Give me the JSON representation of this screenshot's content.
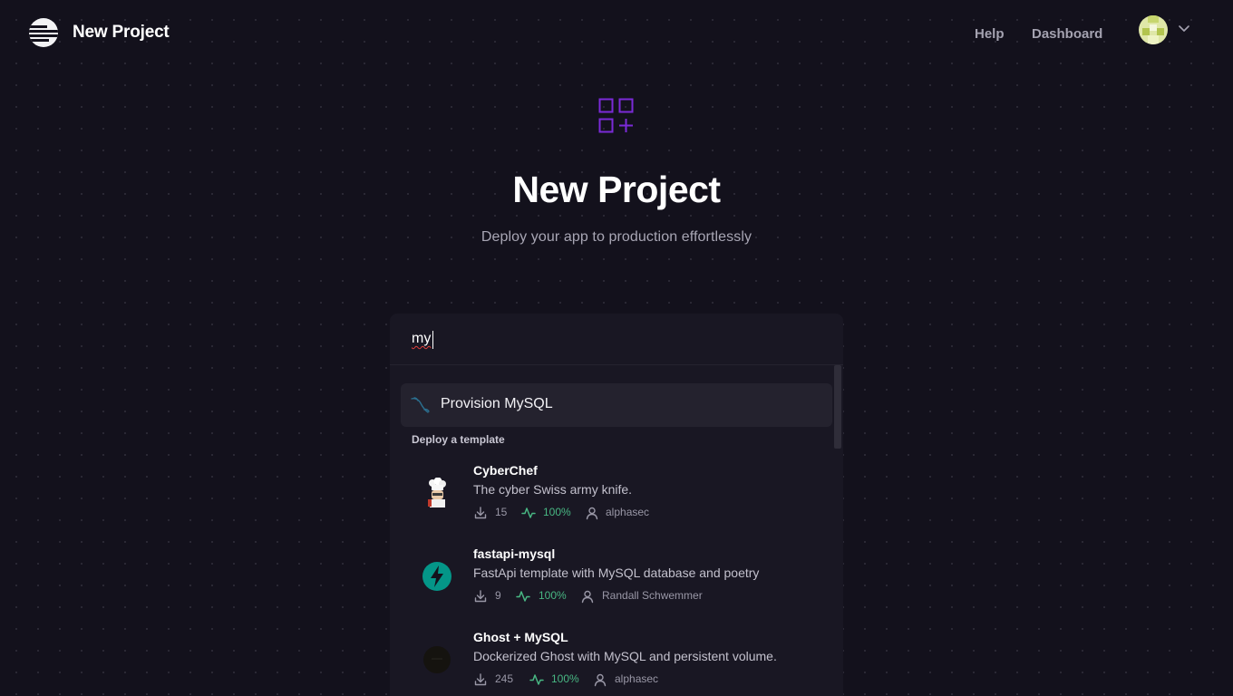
{
  "header": {
    "title": "New Project",
    "nav": {
      "help": "Help",
      "dashboard": "Dashboard"
    }
  },
  "hero": {
    "title": "New Project",
    "subtitle": "Deploy your app to production effortlessly",
    "icon": "grid-plus-icon",
    "accent_color": "#7b2ad8"
  },
  "search": {
    "value": "my",
    "placeholder": ""
  },
  "suggestion": {
    "label": "Provision MySQL",
    "icon": "mysql-icon"
  },
  "templates_section": {
    "label": "Deploy a template",
    "items": [
      {
        "name": "CyberChef",
        "description": "The cyber Swiss army knife.",
        "deploys": "15",
        "health": "100%",
        "author": "alphasec",
        "icon": "chef-icon"
      },
      {
        "name": "fastapi-mysql",
        "description": "FastApi template with MySQL database and poetry",
        "deploys": "9",
        "health": "100%",
        "author": "Randall Schwemmer",
        "icon": "fastapi-icon"
      },
      {
        "name": "Ghost + MySQL",
        "description": "Dockerized Ghost with MySQL and persistent volume.",
        "deploys": "245",
        "health": "100%",
        "author": "alphasec",
        "icon": "ghost-icon"
      }
    ]
  },
  "colors": {
    "background": "#13111c",
    "panel": "#191723",
    "health_green": "#48b783",
    "fastapi_teal": "#049688"
  }
}
